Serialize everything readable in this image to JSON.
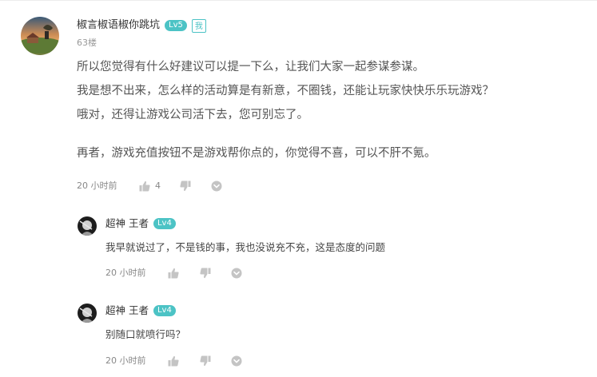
{
  "main_comment": {
    "username": "椒言椒语椒你跳坑",
    "level": "Lv5",
    "me_badge": "我",
    "floor": "63楼",
    "paragraphs": [
      "所以您觉得有什么好建议可以提一下么，让我们大家一起参谋参谋。",
      "我是想不出来，怎么样的活动算是有新意，不圈钱，还能让玩家快快乐乐玩游戏？",
      "哦对，还得让游戏公司活下去，您可别忘了。",
      "再者，游戏充值按钮不是游戏帮你点的，你觉得不喜，可以不肝不氪。"
    ],
    "time": "20 小时前",
    "like_count": "4"
  },
  "replies": [
    {
      "username": "超神 王者",
      "level": "Lv4",
      "text": "我早就说过了，不是钱的事，我也没说充不充，这是态度的问题",
      "time": "20 小时前"
    },
    {
      "username": "超神 王者",
      "level": "Lv4",
      "text": "别随口就喷行吗？",
      "time": "20 小时前"
    }
  ],
  "colors": {
    "accent": "#4cc3c5",
    "icon": "#c4c4c4",
    "muted_text": "#888888"
  },
  "icons": [
    "thumbs-up-icon",
    "thumbs-down-icon",
    "chevron-down-circle-icon"
  ]
}
